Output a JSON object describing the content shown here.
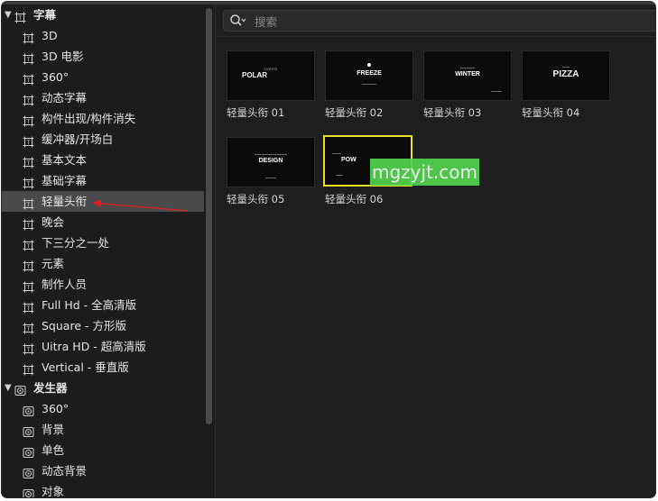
{
  "sidebar": {
    "groups": [
      {
        "label": "字幕",
        "icon": "title-icon",
        "expanded": true,
        "items": [
          {
            "label": "3D"
          },
          {
            "label": "3D 电影"
          },
          {
            "label": "360°"
          },
          {
            "label": "动态字幕"
          },
          {
            "label": "构件出现/构件消失"
          },
          {
            "label": "缓冲器/开场白"
          },
          {
            "label": "基本文本"
          },
          {
            "label": "基础字幕"
          },
          {
            "label": "轻量头衔",
            "selected": true
          },
          {
            "label": "晚会"
          },
          {
            "label": "下三分之一处"
          },
          {
            "label": "元素"
          },
          {
            "label": "制作人员"
          },
          {
            "label": "Full Hd - 全高清版"
          },
          {
            "label": "Square - 方形版"
          },
          {
            "label": "Uitra HD - 超高清版"
          },
          {
            "label": "Vertical - 垂直版"
          }
        ]
      },
      {
        "label": "发生器",
        "icon": "generator-icon",
        "expanded": true,
        "items": [
          {
            "label": "360°"
          },
          {
            "label": "背景"
          },
          {
            "label": "单色"
          },
          {
            "label": "动态背景"
          },
          {
            "label": "对象"
          }
        ]
      }
    ]
  },
  "search": {
    "placeholder": "搜索"
  },
  "tiles": [
    {
      "caption": "轻量头衔 01",
      "thumb_text": "POLAR",
      "thumb_top": "LIGHTS"
    },
    {
      "caption": "轻量头衔 02",
      "thumb_text": "FREEZE"
    },
    {
      "caption": "轻量头衔 03",
      "thumb_text": "WINTER"
    },
    {
      "caption": "轻量头衔 04",
      "thumb_text": "PIZZA"
    },
    {
      "caption": "轻量头衔 05",
      "thumb_text": "DESIGN"
    },
    {
      "caption": "轻量头衔 06",
      "thumb_text": "POW",
      "selected": true
    }
  ],
  "watermark": "mgzyjt.com",
  "colors": {
    "selection_border": "#e6e023",
    "selected_row": "#4a4a4c",
    "arrow": "#e02020",
    "watermark_bg": "#52d44e"
  }
}
